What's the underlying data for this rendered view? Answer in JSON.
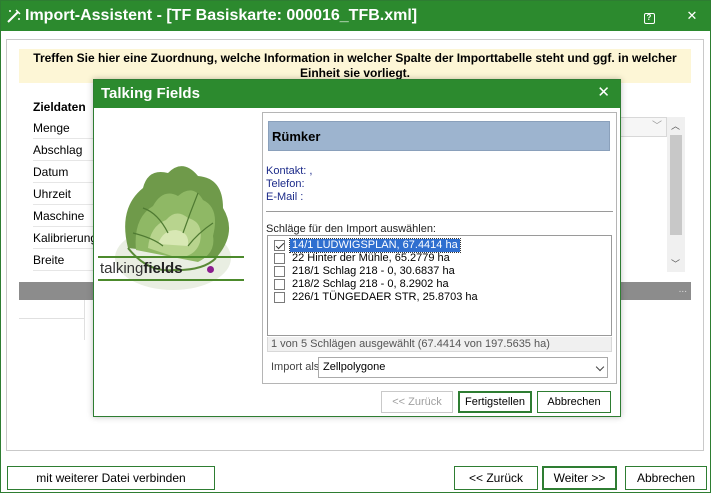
{
  "window": {
    "title": "Import-Assistent - [TF Basiskarte: 000016_TFB.xml]",
    "accent": "#2c8a2e"
  },
  "info_text": "Treffen Sie hier eine Zuordnung, welche Information in welcher Spalte der Importtabelle steht und ggf. in welcher Einheit sie vorliegt.",
  "background_table": {
    "header": "Zieldaten",
    "rows": [
      "Menge",
      "Abschlag",
      "Datum",
      "Uhrzeit",
      "Maschine",
      "Kalibrierung",
      "Breite"
    ],
    "overflow_dots": "..."
  },
  "bottom_buttons": {
    "connect": "mit weiterer Datei verbinden",
    "back": "<<  Zurück",
    "next": "Weiter  >>",
    "cancel": "Abbrechen"
  },
  "dialog": {
    "title": "Talking Fields",
    "logo_text_a": "talking",
    "logo_text_b": "fields",
    "farm_name": "Rümker",
    "contact": "Kontakt: ,",
    "phone": "Telefon:",
    "email": "E-Mail  :",
    "select_label": "Schläge für den Import auswählen:",
    "items": [
      {
        "label": "14/1 LUDWIGSPLAN, 67.4414 ha",
        "checked": true,
        "selected": true
      },
      {
        "label": "22 Hinter der Mühle, 65.2779 ha",
        "checked": false,
        "selected": false
      },
      {
        "label": "218/1 Schlag 218 - 0, 30.6837 ha",
        "checked": false,
        "selected": false
      },
      {
        "label": "218/2 Schlag 218 - 0, 8.2902 ha",
        "checked": false,
        "selected": false
      },
      {
        "label": "226/1 TÜNGEDAER STR, 25.8703 ha",
        "checked": false,
        "selected": false
      }
    ],
    "status": "1 von 5 Schlägen ausgewählt (67.4414 von 197.5635 ha)",
    "import_as_label": "Import als",
    "import_as_value": "Zellpolygone",
    "buttons": {
      "back": "<< Zurück",
      "finish": "Fertigstellen",
      "cancel": "Abbrechen"
    },
    "header_color": "#9db4cf",
    "selection_color": "#2f6fd0",
    "logo_dot_color": "#8b1e8f"
  }
}
